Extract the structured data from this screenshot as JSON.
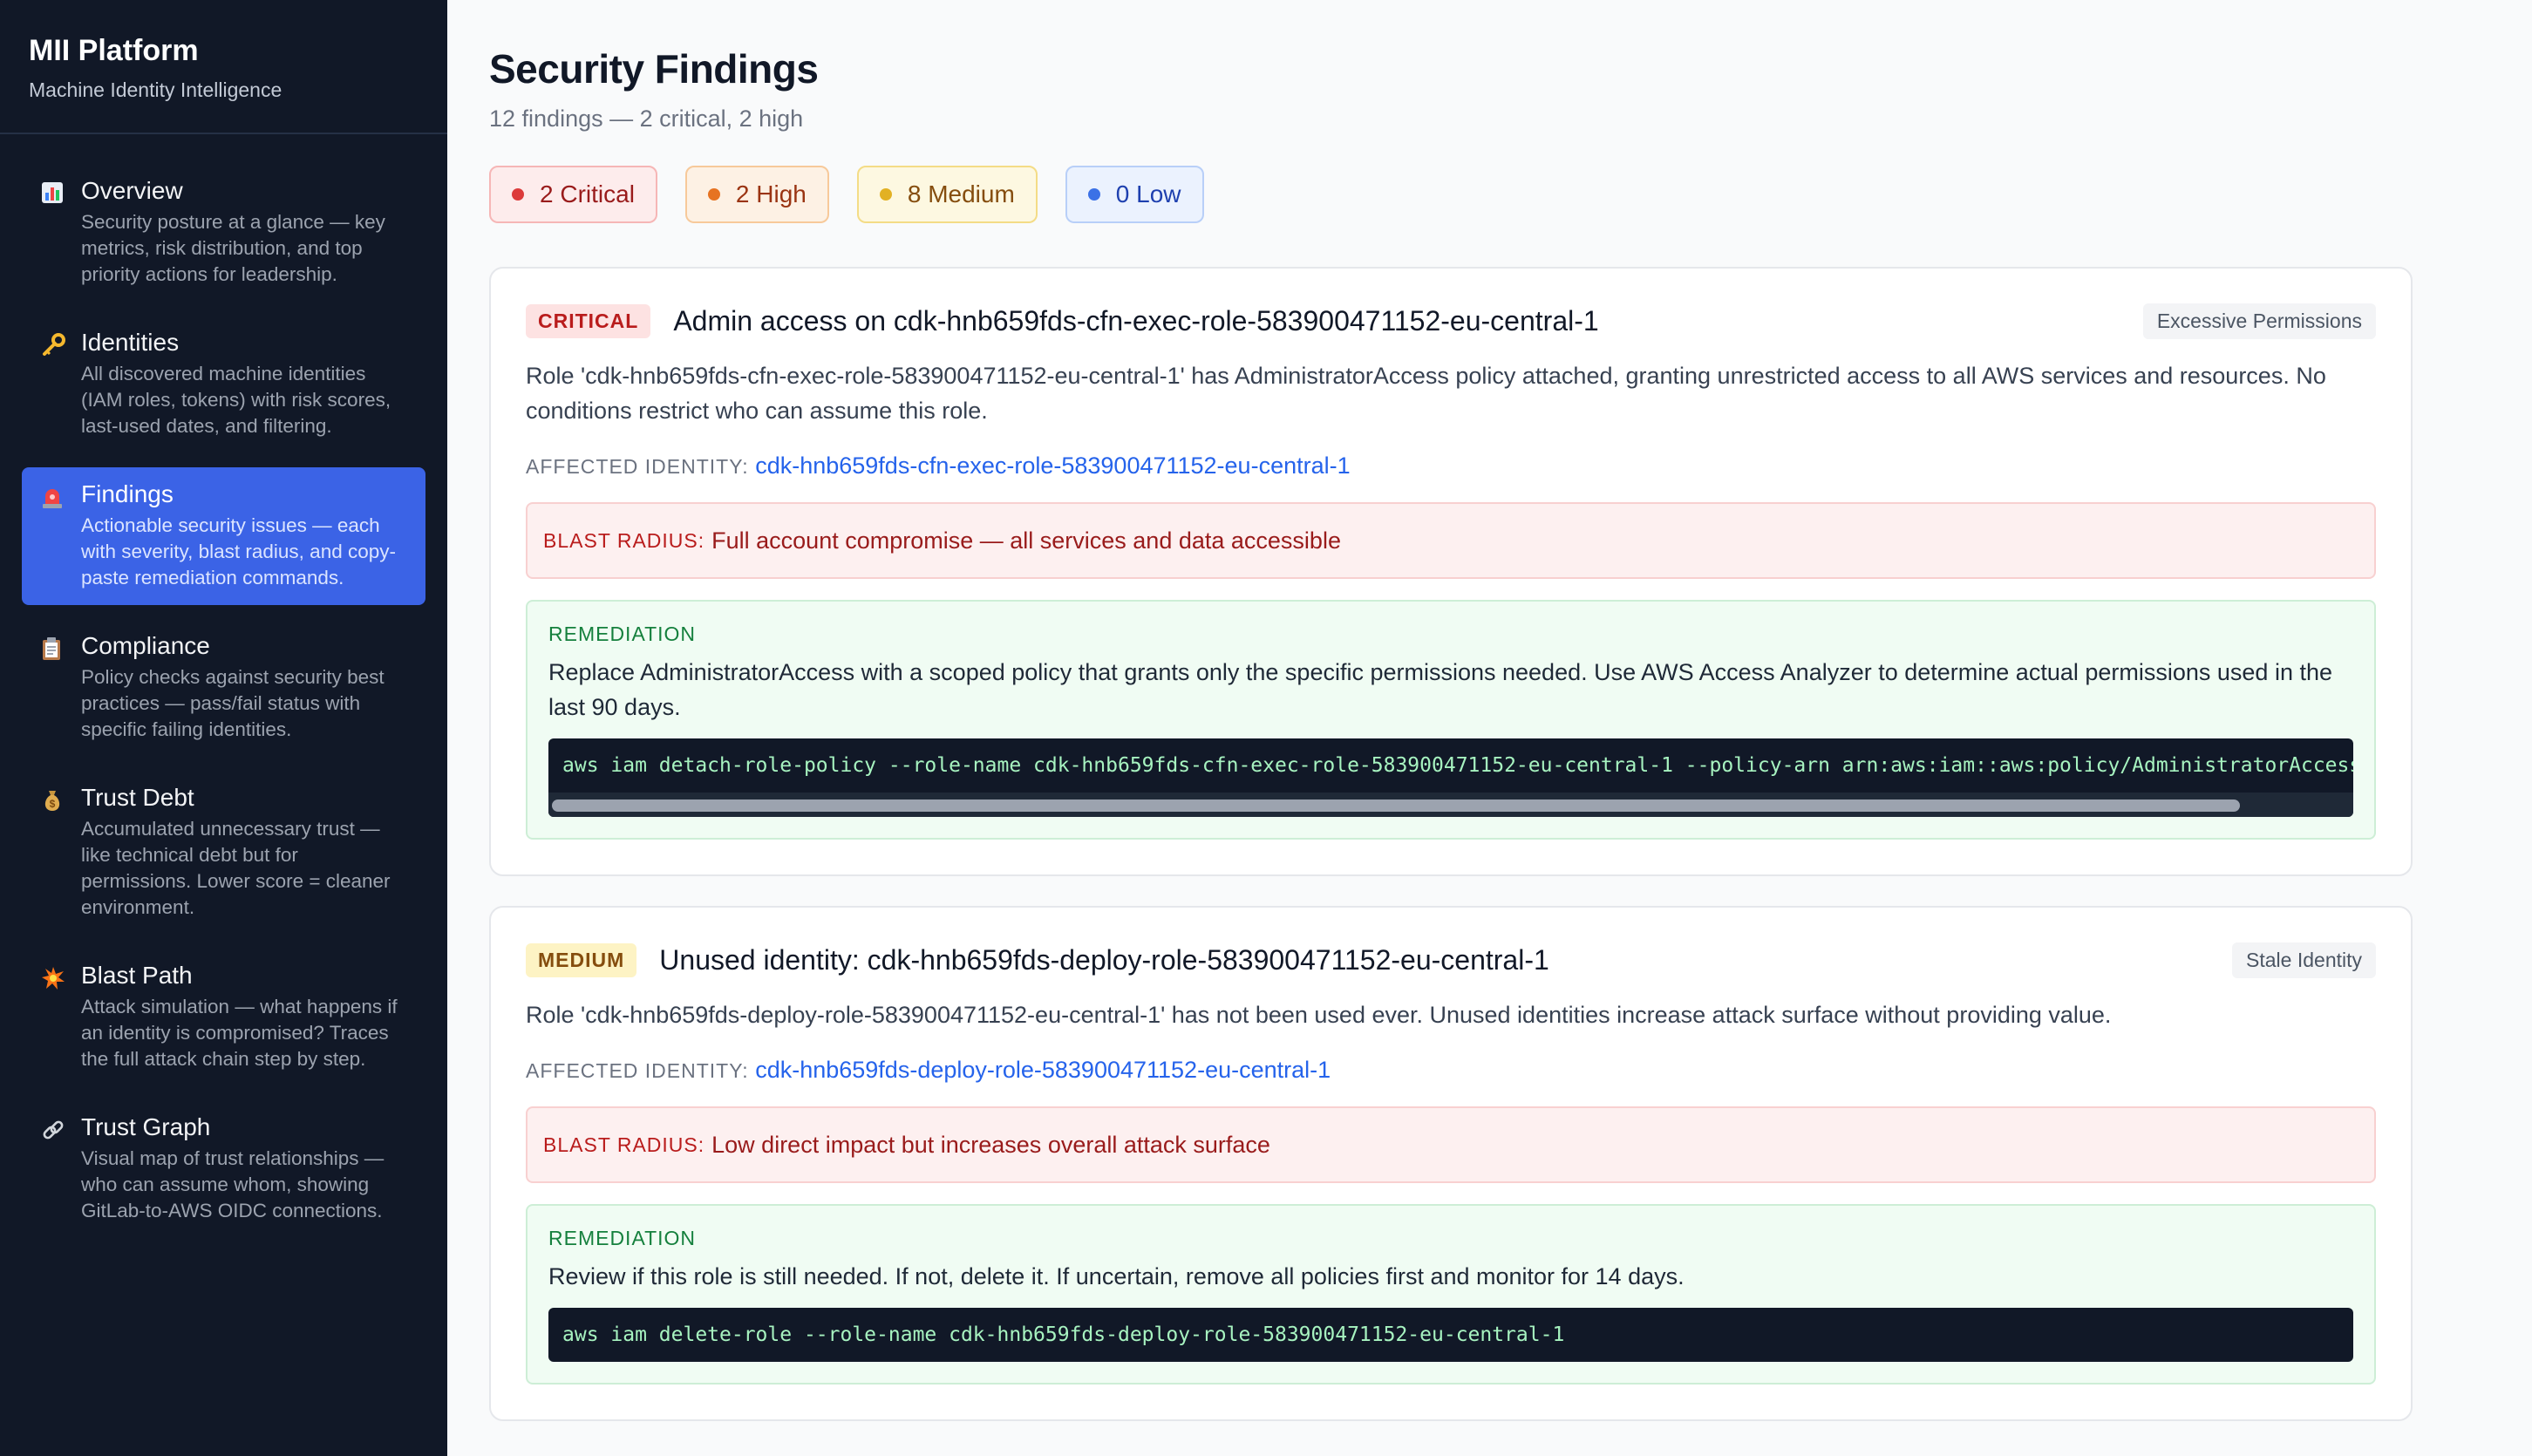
{
  "brand": {
    "title": "MII Platform",
    "subtitle": "Machine Identity Intelligence"
  },
  "nav": [
    {
      "icon": "bar-chart-icon",
      "label": "Overview",
      "desc": "Security posture at a glance — key metrics, risk distribution, and top priority actions for leadership."
    },
    {
      "icon": "key-icon",
      "label": "Identities",
      "desc": "All discovered machine identities (IAM roles, tokens) with risk scores, last-used dates, and filtering."
    },
    {
      "icon": "siren-icon",
      "label": "Findings",
      "desc": "Actionable security issues — each with severity, blast radius, and copy-paste remediation commands.",
      "active": true
    },
    {
      "icon": "clipboard-icon",
      "label": "Compliance",
      "desc": "Policy checks against security best practices — pass/fail status with specific failing identities."
    },
    {
      "icon": "money-bag-icon",
      "label": "Trust Debt",
      "desc": "Accumulated unnecessary trust — like technical debt but for permissions. Lower score = cleaner environment."
    },
    {
      "icon": "explosion-icon",
      "label": "Blast Path",
      "desc": "Attack simulation — what happens if an identity is compromised? Traces the full attack chain step by step."
    },
    {
      "icon": "link-icon",
      "label": "Trust Graph",
      "desc": "Visual map of trust relationships — who can assume whom, showing GitLab-to-AWS OIDC connections."
    }
  ],
  "page": {
    "title": "Security Findings",
    "subtitle": "12 findings — 2 critical, 2 high"
  },
  "summary": {
    "critical": "2 Critical",
    "high": "2 High",
    "medium": "8 Medium",
    "low": "0 Low"
  },
  "labels": {
    "affected": "AFFECTED IDENTITY:",
    "blast": "BLAST RADIUS:",
    "remediation": "REMEDIATION"
  },
  "findings": [
    {
      "severity": "CRITICAL",
      "title": "Admin access on cdk-hnb659fds-cfn-exec-role-583900471152-eu-central-1",
      "category": "Excessive Permissions",
      "description": "Role 'cdk-hnb659fds-cfn-exec-role-583900471152-eu-central-1' has AdministratorAccess policy attached, granting unrestricted access to all AWS services and resources. No conditions restrict who can assume this role.",
      "affected": "cdk-hnb659fds-cfn-exec-role-583900471152-eu-central-1",
      "blast": "Full account compromise — all services and data accessible",
      "remediation": "Replace AdministratorAccess with a scoped policy that grants only the specific permissions needed. Use AWS Access Analyzer to determine actual permissions used in the last 90 days.",
      "command": "aws iam detach-role-policy --role-name cdk-hnb659fds-cfn-exec-role-583900471152-eu-central-1 --policy-arn arn:aws:iam::aws:policy/AdministratorAccess"
    },
    {
      "severity": "MEDIUM",
      "title": "Unused identity: cdk-hnb659fds-deploy-role-583900471152-eu-central-1",
      "category": "Stale Identity",
      "description": "Role 'cdk-hnb659fds-deploy-role-583900471152-eu-central-1' has not been used ever. Unused identities increase attack surface without providing value.",
      "affected": "cdk-hnb659fds-deploy-role-583900471152-eu-central-1",
      "blast": "Low direct impact but increases overall attack surface",
      "remediation": "Review if this role is still needed. If not, delete it. If uncertain, remove all policies first and monitor for 14 days.",
      "command": "aws iam delete-role --role-name cdk-hnb659fds-deploy-role-583900471152-eu-central-1"
    }
  ],
  "colors": {
    "sidebar_bg": "#111827",
    "active_nav": "#3b63e6",
    "critical": "#dc3b3b",
    "high": "#e67322",
    "medium": "#e2b123",
    "low": "#3b71e6",
    "link": "#2563eb"
  }
}
